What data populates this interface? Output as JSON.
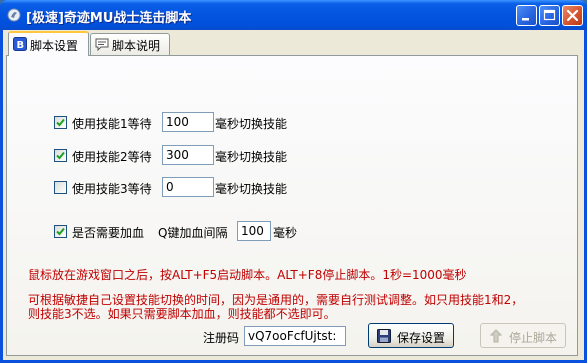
{
  "window": {
    "title": "[极速]奇迹MU战士连击脚本"
  },
  "tabs": [
    {
      "label": "脚本设置",
      "active": true
    },
    {
      "label": "脚本说明",
      "active": false
    }
  ],
  "skills": [
    {
      "label": "使用技能1等待",
      "checked": true,
      "value": "100",
      "suffix": "毫秒切换技能"
    },
    {
      "label": "使用技能2等待",
      "checked": true,
      "value": "300",
      "suffix": "毫秒切换技能"
    },
    {
      "label": "使用技能3等待",
      "checked": false,
      "value": "0",
      "suffix": "毫秒切换技能"
    }
  ],
  "heal": {
    "label": "是否需要加血",
    "checked": true,
    "interval_label": "Q键加血间隔",
    "value": "100",
    "suffix": "毫秒"
  },
  "notes": {
    "line1": "鼠标放在游戏窗口之后，按ALT+F5启动脚本。ALT+F8停止脚本。1秒=1000毫秒",
    "line2": "可根据敏捷自己设置技能切换的时间，因为是通用的，需要自行测试调整。如只用技能1和2，",
    "line3": "则技能3不选。如果只需要脚本加血，则技能都不选即可。"
  },
  "registration": {
    "label": "注册码",
    "value": "vQ7ooFcfUjtst:"
  },
  "buttons": {
    "save": "保存设置",
    "stop": "停止脚本"
  },
  "colors": {
    "note_text": "#c00000",
    "title_bar": "#0454e0",
    "panel_bg": "#ece9d8"
  }
}
